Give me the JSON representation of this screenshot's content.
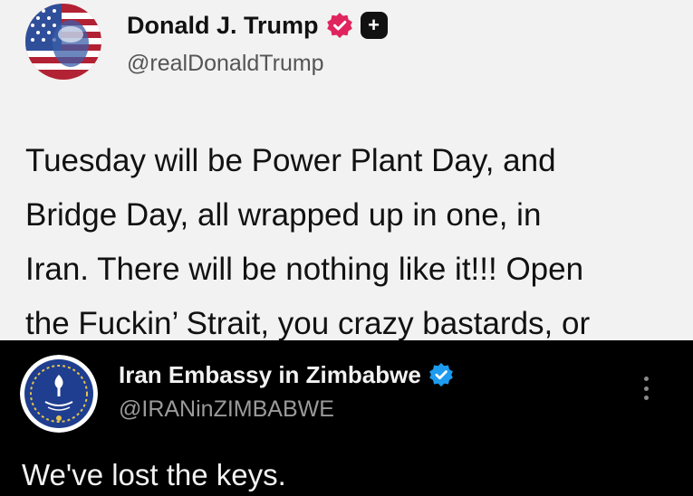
{
  "top_post": {
    "author_name": "Donald J. Trump",
    "handle": "@realDonaldTrump",
    "verified_badge_color": "#e0245e",
    "plus_badge_symbol": "+",
    "text_lines": [
      "Tuesday will be Power Plant Day, and",
      "Bridge Day, all wrapped up in one, in",
      "Iran. There will be nothing like it!!! Open",
      "the Fuckin’ Strait, you crazy bastards, or"
    ],
    "background": "#f2f2f2",
    "avatar_icon": "american-flag-portrait"
  },
  "bottom_post": {
    "author_name": "Iran Embassy in Zimbabwe",
    "handle": "@IRANinZIMBABWE",
    "verified_badge_color": "#1d9bf0",
    "text": "We've lost the keys.",
    "background": "#000000",
    "avatar_icon": "embassy-emblem",
    "more_icon": "more-options-icon"
  }
}
